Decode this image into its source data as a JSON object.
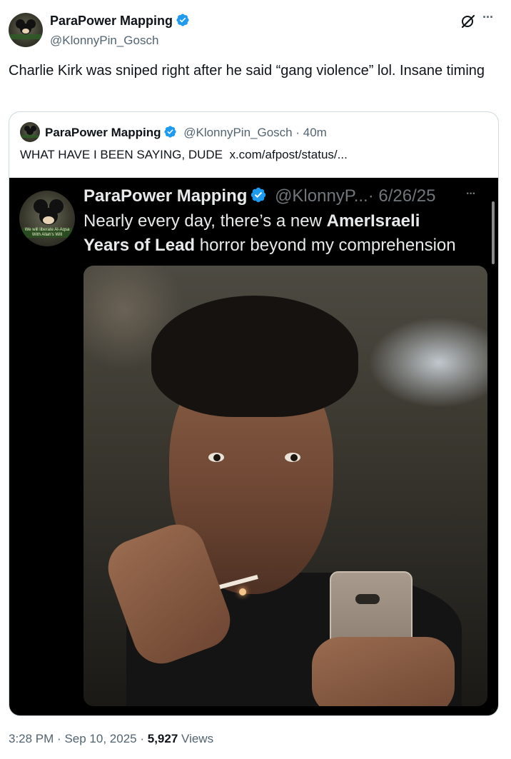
{
  "tweet": {
    "author_name": "ParaPower Mapping",
    "handle": "@KlonnyPin_Gosch",
    "text": "Charlie Kirk was sniped right after he said “gang violence” lol. Insane timing",
    "time": "3:28 PM",
    "date": "Sep 10, 2025",
    "views_count": "5,927",
    "views_label": "Views",
    "separator": "·",
    "more_label": "···",
    "grok_icon": "grok-icon",
    "more_icon": "more-icon",
    "verified_icon": "verified-badge-icon"
  },
  "quote": {
    "author_name": "ParaPower Mapping",
    "handle": "@KlonnyPin_Gosch",
    "time_ago": "· 40m",
    "text": "WHAT HAVE I BEEN SAYING, DUDE  x.com/afpost/status/..."
  },
  "screenshot": {
    "author_name": "ParaPower Mapping",
    "handle": "@KlonnyP...",
    "date": "· 6/26/25",
    "more_label": "···",
    "text_part1": "Nearly every day, there’s a new ",
    "text_bold1": "AmerIsraeli",
    "text_bold2": "Years of Lead",
    "text_part2": " horror beyond my comprehension",
    "avatar_caption": "We will liberate Al-Aqsa With Allah's Will"
  },
  "colors": {
    "verified": "#1d9bf0",
    "text_primary": "#0f1419",
    "text_secondary": "#536471",
    "border": "#cfd9de"
  }
}
